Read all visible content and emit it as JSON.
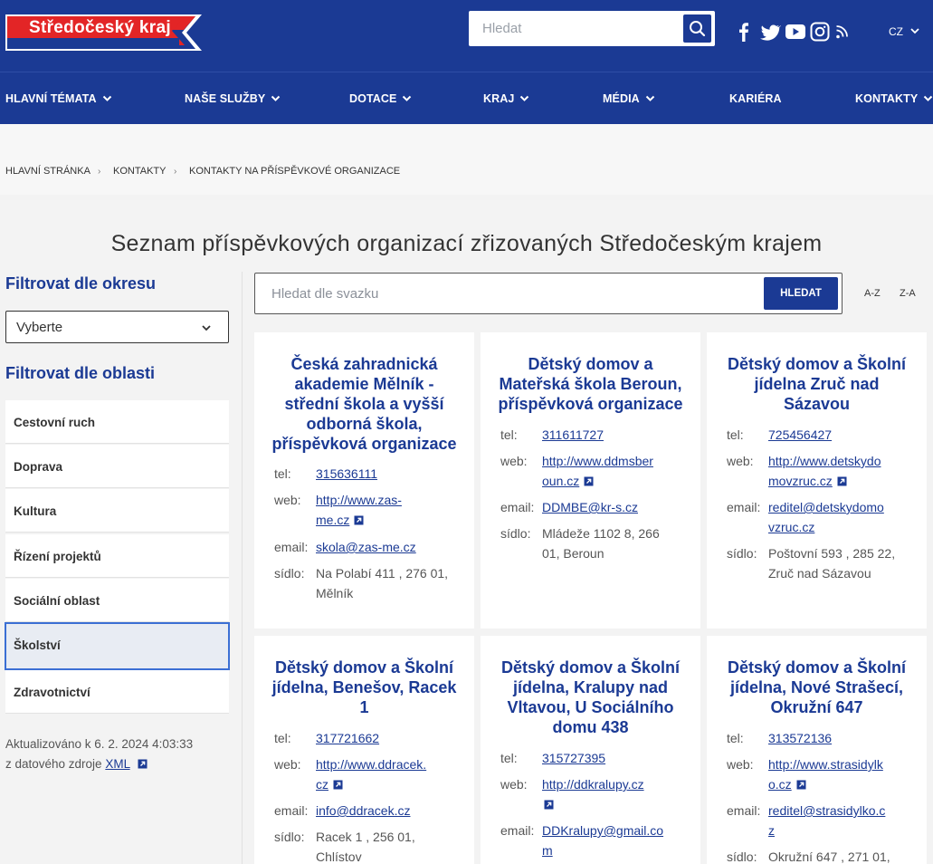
{
  "header": {
    "logo_text": "Středočeský kraj",
    "search_placeholder": "Hledat",
    "lang": "CZ",
    "social_icons": [
      "facebook-icon",
      "twitter-icon",
      "youtube-icon",
      "instagram-icon",
      "rss-icon"
    ],
    "colors": {
      "primary": "#1b3a94",
      "logo_red": "#e32526"
    }
  },
  "nav": [
    {
      "label": "HLAVNÍ TÉMATA",
      "has_dropdown": true
    },
    {
      "label": "NAŠE SLUŽBY",
      "has_dropdown": true
    },
    {
      "label": "DOTACE",
      "has_dropdown": true
    },
    {
      "label": "KRAJ",
      "has_dropdown": true
    },
    {
      "label": "MÉDIA",
      "has_dropdown": true
    },
    {
      "label": "KARIÉRA",
      "has_dropdown": false
    },
    {
      "label": "KONTAKTY",
      "has_dropdown": true
    }
  ],
  "breadcrumb": [
    "HLAVNÍ STRÁNKA",
    "KONTAKTY",
    "KONTAKTY NA PŘÍSPĚVKOVÉ ORGANIZACE"
  ],
  "page_title": "Seznam příspěvkových organizací zřizovaných Středočeským krajem",
  "sidebar": {
    "district_heading": "Filtrovat dle okresu",
    "district_select": "Vyberte",
    "area_heading": "Filtrovat dle oblasti",
    "areas": [
      "Cestovní ruch",
      "Doprava",
      "Kultura",
      "Řízení projektů",
      "Sociální oblast",
      "Školství",
      "Zdravotnictví"
    ],
    "active_area": "Školství",
    "updated_line1": "Aktualizováno k 6. 2. 2024 4:03:33",
    "updated_line2": "z datového zdroje",
    "updated_link": "XML"
  },
  "main": {
    "search_placeholder": "Hledat dle svazku",
    "search_button": "HLEDAT",
    "sort_az": "A-Z",
    "sort_za": "Z-A"
  },
  "labels": {
    "tel": "tel:",
    "web": "web:",
    "email": "email:",
    "sidlo": "sídlo:"
  },
  "cards": [
    {
      "title_lines": [
        "Česká zahradnická",
        "akademie Mělník -",
        "střední škola a vyšší",
        "odborná škola,",
        "příspěvková organizace"
      ],
      "tel": "315636111",
      "web_lines": [
        "http://www.zas-",
        "me.cz"
      ],
      "email": "skola@zas-me.cz",
      "sidlo_lines": [
        "Na Polabí 411 , 276 01,",
        "Mělník"
      ]
    },
    {
      "title_lines": [
        "Dětský domov a",
        "Mateřská škola Beroun,",
        "příspěvková organizace"
      ],
      "tel": "311611727",
      "web_lines": [
        "http://www.ddmsber",
        "oun.cz"
      ],
      "email": "DDMBE@kr-s.cz",
      "sidlo_lines": [
        "Mládeže 1102 8, 266",
        "01, Beroun"
      ]
    },
    {
      "title_lines": [
        "Dětský domov a Školní",
        "jídelna Zruč nad",
        "Sázavou"
      ],
      "tel": "725456427",
      "web_lines": [
        "http://www.detskydo",
        "movzruc.cz"
      ],
      "email_lines": [
        "reditel@detskydomo",
        "vzruc.cz"
      ],
      "sidlo_lines": [
        "Poštovní 593 , 285 22,",
        "Zruč nad Sázavou"
      ]
    },
    {
      "title_lines": [
        "Dětský domov a Školní",
        "jídelna, Benešov, Racek",
        "1"
      ],
      "tel": "317721662",
      "web_lines": [
        "http://www.ddracek.",
        "cz"
      ],
      "email": "info@ddracek.cz",
      "sidlo_lines": [
        "Racek 1 , 256 01,",
        "Chlístov"
      ]
    },
    {
      "title_lines": [
        "Dětský domov a Školní",
        "jídelna, Kralupy nad",
        "Vltavou, U Sociálního",
        "domu 438"
      ],
      "tel": "315727395",
      "web_lines": [
        "http://ddkralupy.cz",
        ""
      ],
      "email_lines": [
        "DDKralupy@gmail.co",
        "m"
      ]
    },
    {
      "title_lines": [
        "Dětský domov a Školní",
        "jídelna, Nové Strašecí,",
        "Okružní 647"
      ],
      "tel": "313572136",
      "web_lines": [
        "http://www.strasidylk",
        "o.cz"
      ],
      "email_lines": [
        "reditel@strasidylko.c",
        "z"
      ],
      "sidlo_lines": [
        "Okružní 647 , 271 01,"
      ]
    }
  ]
}
